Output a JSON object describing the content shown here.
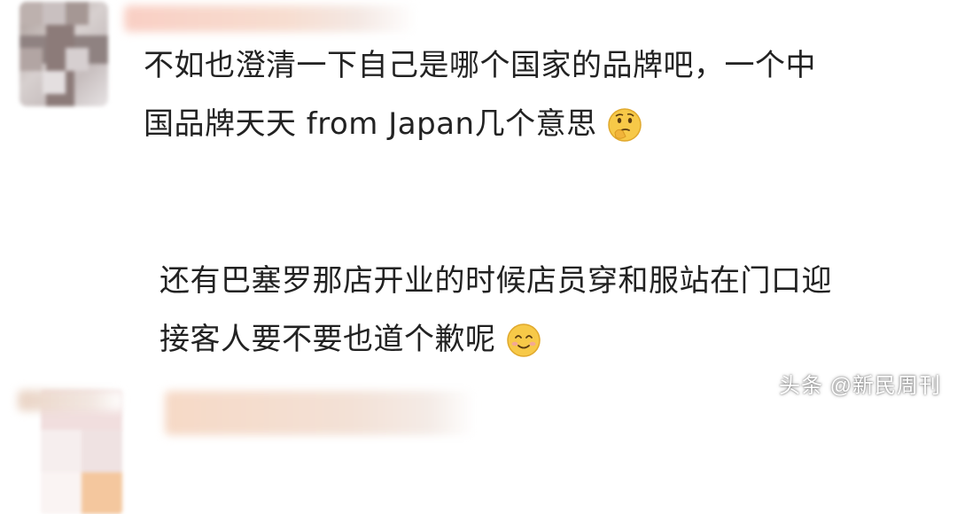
{
  "comments": [
    {
      "avatar": "blurred-avatar",
      "username": "",
      "text_lines": [
        "不如也澄清一下自己是哪个国家的品牌吧，一个中",
        "国品牌天天 from Japan几个意思"
      ],
      "emoji": "thinking-face-icon"
    },
    {
      "avatar": "blurred-avatar",
      "username": "",
      "text_lines": [
        "还有巴塞罗那店开业的时候店员穿和服站在门口迎",
        "接客人要不要也道个歉呢"
      ],
      "emoji": "smiling-face-icon"
    }
  ],
  "watermark": "头条 @新民周刊",
  "colors": {
    "text": "#222222",
    "background": "#ffffff",
    "emoji_yellow": "#f7c948",
    "emoji_blush": "#f2a2a2"
  }
}
